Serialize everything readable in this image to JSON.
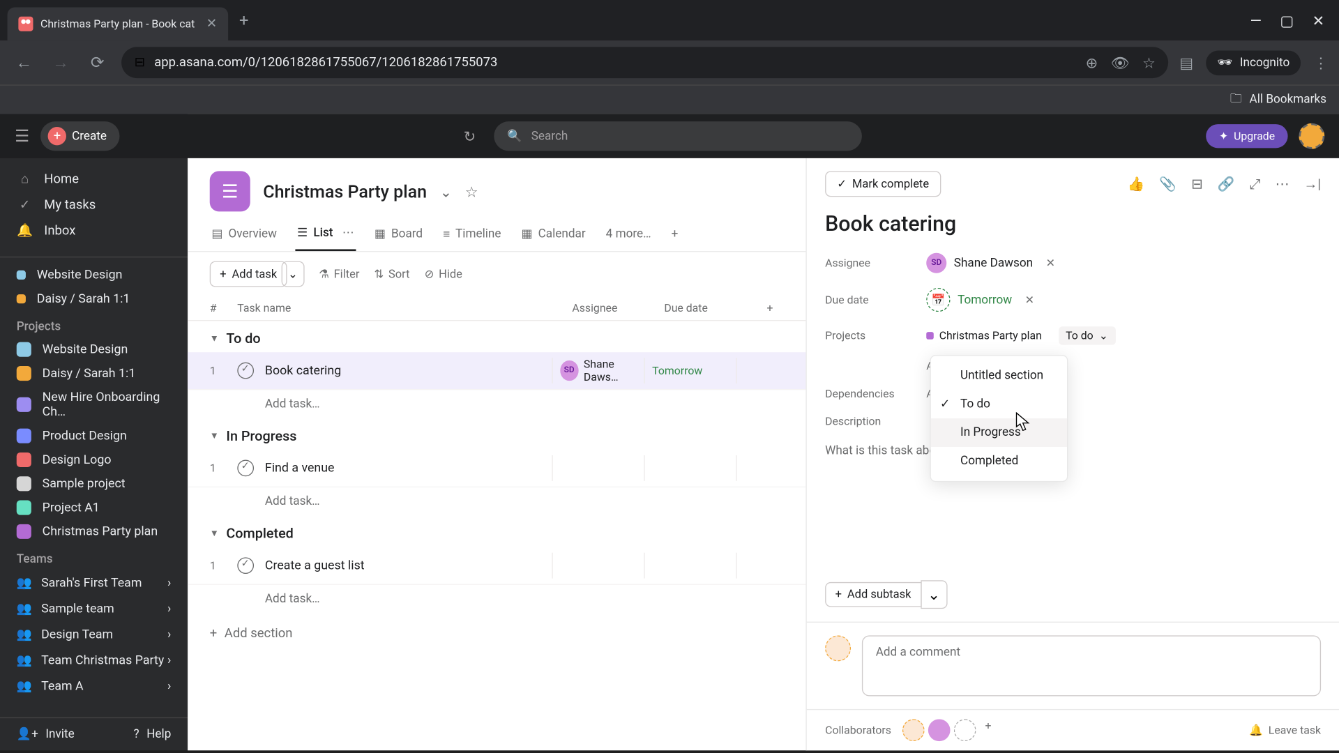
{
  "browser": {
    "tab_title": "Christmas Party plan - Book cat",
    "url": "app.asana.com/0/1206182861755067/1206182861755073",
    "incognito": "Incognito",
    "all_bookmarks": "All Bookmarks"
  },
  "topbar": {
    "create": "Create",
    "search_placeholder": "Search",
    "upgrade": "Upgrade"
  },
  "sidebar": {
    "home": "Home",
    "my_tasks": "My tasks",
    "inbox": "Inbox",
    "recent": [
      {
        "label": "Website Design",
        "color": "#8ecae6"
      },
      {
        "label": "Daisy / Sarah 1:1",
        "color": "#f2a93b"
      }
    ],
    "projects_label": "Projects",
    "projects": [
      {
        "label": "Website Design",
        "color": "#8ecae6"
      },
      {
        "label": "Daisy / Sarah 1:1",
        "color": "#f2a93b"
      },
      {
        "label": "New Hire Onboarding Ch…",
        "color": "#9d8df1"
      },
      {
        "label": "Product Design",
        "color": "#7a8cff"
      },
      {
        "label": "Design Logo",
        "color": "#f06a6a"
      },
      {
        "label": "Sample project",
        "color": "#d6d6d6"
      },
      {
        "label": "Project A1",
        "color": "#66e0c2"
      },
      {
        "label": "Christmas Party plan",
        "color": "#b36bd4"
      }
    ],
    "teams_label": "Teams",
    "teams": [
      "Sarah's First Team",
      "Sample team",
      "Design Team",
      "Team Christmas Party",
      "Team A"
    ],
    "invite": "Invite",
    "help": "Help"
  },
  "project": {
    "title": "Christmas Party plan",
    "tabs": {
      "overview": "Overview",
      "list": "List",
      "board": "Board",
      "timeline": "Timeline",
      "calendar": "Calendar",
      "more": "4 more…"
    },
    "toolbar": {
      "add_task": "Add task",
      "filter": "Filter",
      "sort": "Sort",
      "hide": "Hide"
    },
    "columns": {
      "num": "#",
      "name": "Task name",
      "assignee": "Assignee",
      "due": "Due date"
    },
    "sections": [
      {
        "name": "To do",
        "tasks": [
          {
            "num": "1",
            "name": "Book catering",
            "assignee": "Shane Daws…",
            "due": "Tomorrow",
            "selected": true
          }
        ]
      },
      {
        "name": "In Progress",
        "tasks": [
          {
            "num": "1",
            "name": "Find a venue",
            "assignee": "",
            "due": ""
          }
        ]
      },
      {
        "name": "Completed",
        "tasks": [
          {
            "num": "1",
            "name": "Create a guest list",
            "assignee": "",
            "due": ""
          }
        ]
      }
    ],
    "add_task_placeholder": "Add task…",
    "add_section": "Add section"
  },
  "detail": {
    "mark_complete": "Mark complete",
    "title": "Book catering",
    "fields": {
      "assignee_label": "Assignee",
      "assignee_value": "Shane Dawson",
      "assignee_initials": "SD",
      "due_label": "Due date",
      "due_value": "Tomorrow",
      "projects_label": "Projects",
      "project_value": "Christmas Party plan",
      "section_value": "To do",
      "add_to_projects": "Ad",
      "dependencies_label": "Dependencies",
      "add_dependencies": "Ad",
      "description_label": "Description",
      "description_placeholder": "What is this task about?"
    },
    "add_subtask": "Add subtask",
    "comment_placeholder": "Add a comment",
    "collaborators": "Collaborators",
    "leave_task": "Leave task"
  },
  "dropdown": {
    "items": [
      {
        "label": "Untitled section",
        "checked": false
      },
      {
        "label": "To do",
        "checked": true
      },
      {
        "label": "In Progress",
        "checked": false,
        "hover": true
      },
      {
        "label": "Completed",
        "checked": false
      }
    ]
  }
}
